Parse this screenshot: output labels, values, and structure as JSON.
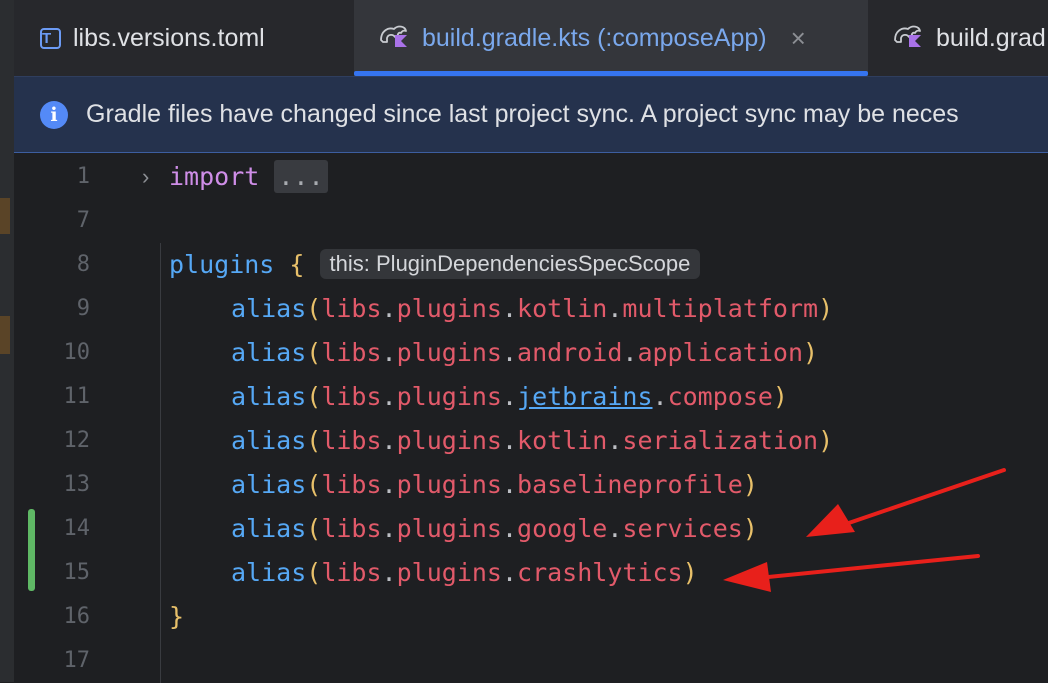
{
  "tabs": [
    {
      "label": "libs.versions.toml",
      "icon": "toml-file-icon",
      "active": false
    },
    {
      "label": "build.gradle.kts (:composeApp)",
      "icon": "gradle-kotlin-icon",
      "active": true,
      "close": "×"
    },
    {
      "label": "build.grad",
      "icon": "gradle-kotlin-icon",
      "active": false
    }
  ],
  "banner": {
    "icon": "info-icon",
    "info_glyph": "i",
    "text": "Gradle files have changed since last project sync. A project sync may be neces"
  },
  "toml_glyph": "T",
  "fold_glyph": "›",
  "editor": {
    "line_numbers": [
      "1",
      "7",
      "8",
      "9",
      "10",
      "11",
      "12",
      "13",
      "14",
      "15",
      "16",
      "17"
    ],
    "import_kw": "import",
    "import_folded": "...",
    "plugins_kw": "plugins",
    "brace_open": "{",
    "brace_close": "}",
    "inlay_hint": "this: PluginDependenciesSpecScope",
    "alias": "alias",
    "paren_open": "(",
    "paren_close": ")",
    "dot": ".",
    "libs": "libs",
    "plugins_ref": "plugins",
    "aliases": [
      [
        "kotlin",
        "multiplatform"
      ],
      [
        "android",
        "application"
      ],
      [
        "jetbrains",
        "compose"
      ],
      [
        "kotlin",
        "serialization"
      ],
      [
        "baselineprofile"
      ],
      [
        "google",
        "services"
      ],
      [
        "crashlytics"
      ]
    ]
  },
  "colors": {
    "keyword": "#cf8ee8",
    "function": "#56a8f5",
    "bracket": "#e8c06a",
    "identifier": "#e25a6a",
    "arrow": "#e8201b",
    "modified_gutter": "#5fb865"
  }
}
